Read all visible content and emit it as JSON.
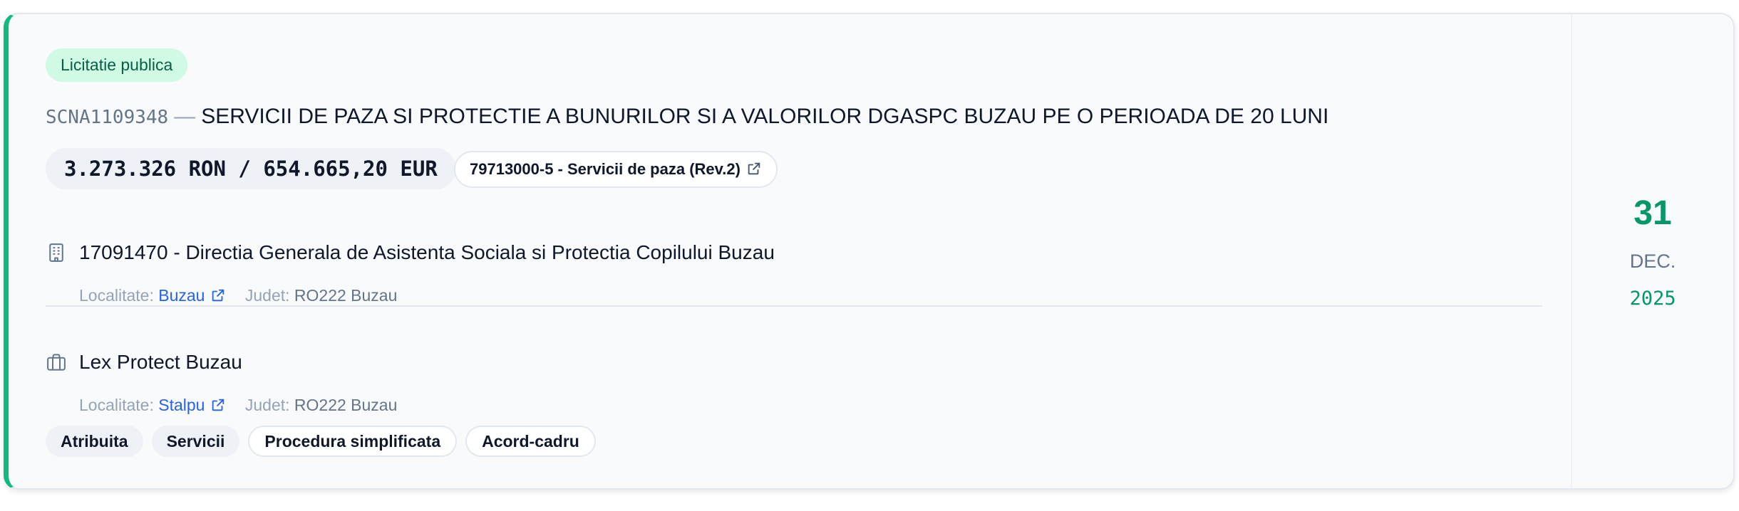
{
  "tender": {
    "type_badge": "Licitatie publica",
    "code": "SCNA1109348",
    "separator": "—",
    "title": "SERVICII DE PAZA SI PROTECTIE A BUNURILOR SI A VALORILOR DGASPC BUZAU PE O PERIOADA DE 20 LUNI",
    "value": "3.273.326 RON / 654.665,20 EUR",
    "cpv": "79713000-5 - Servicii de paza (Rev.2)"
  },
  "authority": {
    "icon": "building-icon",
    "name": "17091470 - Directia Generala de Asistenta Sociala si Protectia Copilului Buzau",
    "locality_label": "Localitate:",
    "locality": "Buzau",
    "county_label": "Judet:",
    "county": "RO222 Buzau"
  },
  "supplier": {
    "icon": "briefcase-icon",
    "name": "Lex Protect Buzau",
    "locality_label": "Localitate:",
    "locality": "Stalpu",
    "county_label": "Judet:",
    "county": "RO222 Buzau"
  },
  "tags": [
    "Atribuita",
    "Servicii",
    "Procedura simplificata",
    "Acord-cadru"
  ],
  "date": {
    "day": "31",
    "month": "DEC.",
    "year": "2025"
  },
  "colors": {
    "accent": "#10b981",
    "badge_bg": "#d1fae5",
    "link": "#2563eb",
    "date": "#059669"
  }
}
